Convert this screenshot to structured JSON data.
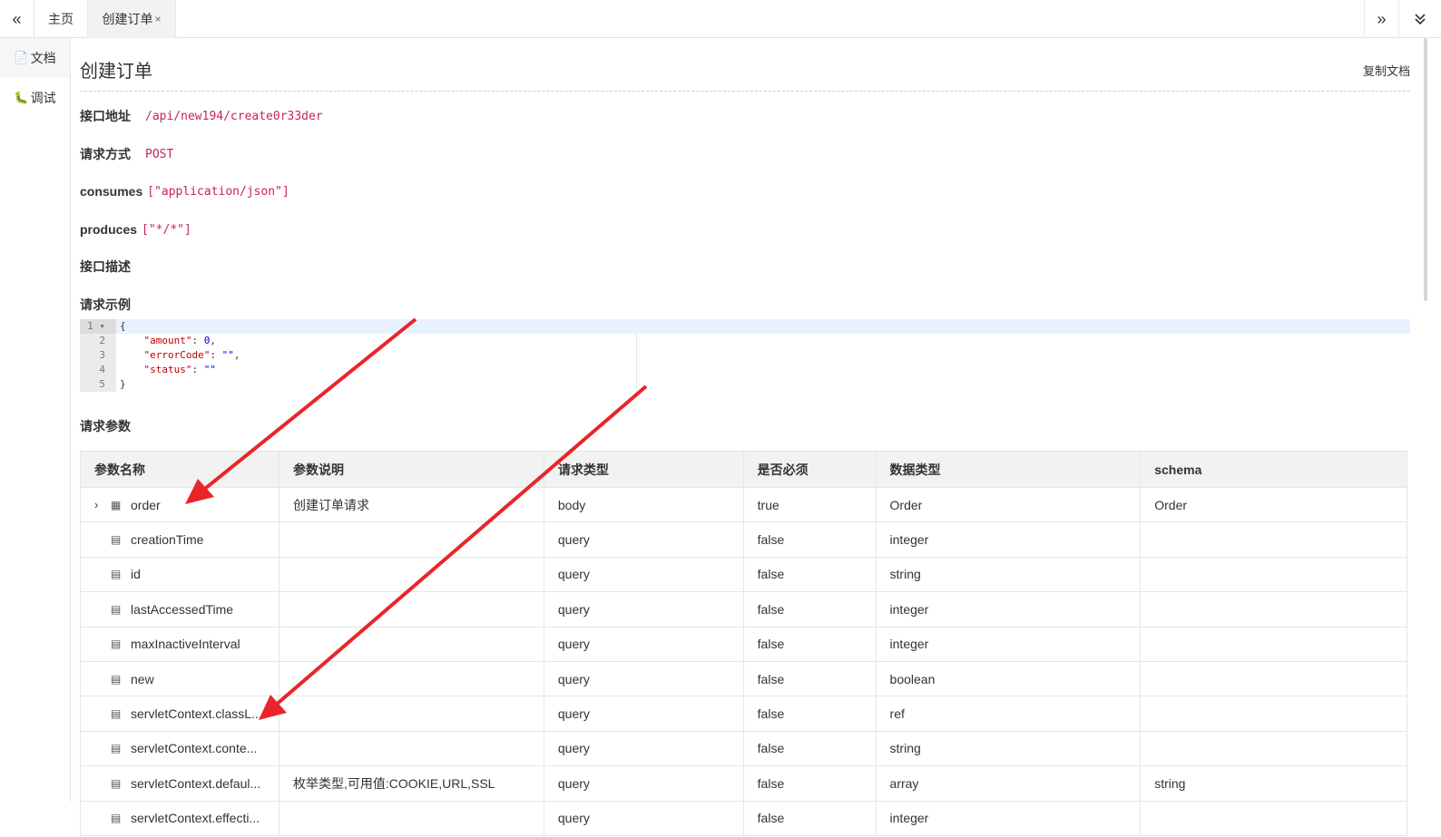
{
  "tabs": {
    "prev_icon": "«",
    "home": "主页",
    "active": "创建订单",
    "close": "×",
    "next_icon": "»",
    "dropdown_icon": "chevron-double-down-icon"
  },
  "sidebar": {
    "items": [
      {
        "icon": "file-icon",
        "label": "文档"
      },
      {
        "icon": "bug-icon",
        "label": "调试"
      }
    ]
  },
  "doc": {
    "title": "创建订单",
    "copy_label": "复制文档",
    "fields": [
      {
        "label": "接口地址",
        "value": "/api/new194/create0r33der"
      },
      {
        "label": "请求方式",
        "value": "POST"
      },
      {
        "label": "consumes",
        "value": "[\"application/json\"]"
      },
      {
        "label": "produces",
        "value": "[\"*/*\"]"
      },
      {
        "label": "接口描述",
        "value": ""
      },
      {
        "label": "请求示例",
        "value": ""
      }
    ],
    "example": {
      "line_numbers": [
        "1",
        "2",
        "3",
        "4",
        "5"
      ],
      "lines": [
        {
          "text": "{"
        },
        {
          "key": "\"amount\"",
          "value": "0",
          "suffix": ","
        },
        {
          "key": "\"errorCode\"",
          "value": "\"\"",
          "suffix": ","
        },
        {
          "key": "\"status\"",
          "value": "\"\"",
          "suffix": ""
        },
        {
          "text": "}"
        }
      ]
    },
    "params_heading": "请求参数"
  },
  "table": {
    "headers": [
      "参数名称",
      "参数说明",
      "请求类型",
      "是否必须",
      "数据类型",
      "schema"
    ],
    "rows": [
      {
        "name": "order",
        "expandable": true,
        "desc": "创建订单请求",
        "type": "body",
        "required": "true",
        "datatype": "Order",
        "schema": "Order"
      },
      {
        "name": "creationTime",
        "expandable": false,
        "desc": "",
        "type": "query",
        "required": "false",
        "datatype": "integer",
        "schema": ""
      },
      {
        "name": "id",
        "expandable": false,
        "desc": "",
        "type": "query",
        "required": "false",
        "datatype": "string",
        "schema": ""
      },
      {
        "name": "lastAccessedTime",
        "expandable": false,
        "desc": "",
        "type": "query",
        "required": "false",
        "datatype": "integer",
        "schema": ""
      },
      {
        "name": "maxInactiveInterval",
        "expandable": false,
        "desc": "",
        "type": "query",
        "required": "false",
        "datatype": "integer",
        "schema": ""
      },
      {
        "name": "new",
        "expandable": false,
        "desc": "",
        "type": "query",
        "required": "false",
        "datatype": "boolean",
        "schema": ""
      },
      {
        "name": "servletContext.classL...",
        "expandable": false,
        "desc": "",
        "type": "query",
        "required": "false",
        "datatype": "ref",
        "schema": ""
      },
      {
        "name": "servletContext.conte...",
        "expandable": false,
        "desc": "",
        "type": "query",
        "required": "false",
        "datatype": "string",
        "schema": ""
      },
      {
        "name": "servletContext.defaul...",
        "expandable": false,
        "desc": "枚举类型,可用值:COOKIE,URL,SSL",
        "type": "query",
        "required": "false",
        "datatype": "array",
        "schema": "string"
      },
      {
        "name": "servletContext.effecti...",
        "expandable": false,
        "desc": "",
        "type": "query",
        "required": "false",
        "datatype": "integer",
        "schema": ""
      }
    ]
  },
  "colors": {
    "code_red": "#c7254e",
    "body_blue": "#1e6bb8",
    "query_blue": "#4aa3df",
    "required_red": "#e02020",
    "annotation_arrow": "#e8262a"
  }
}
